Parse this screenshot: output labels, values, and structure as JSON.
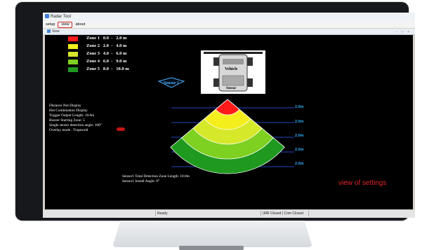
{
  "window": {
    "title": "Radar Tool",
    "menu": [
      "setup",
      "view",
      "about"
    ],
    "active_menu": "view",
    "subwindow_title": "View",
    "controls": "– □ ×"
  },
  "legend": [
    {
      "label": "Zone 1",
      "from": "0.0",
      "to": "2.0 m",
      "color": "#ff1a1a"
    },
    {
      "label": "Zone 2",
      "from": "2.0",
      "to": "4.0 m",
      "color": "#f4ee1c"
    },
    {
      "label": "Zone 3",
      "from": "4.0",
      "to": "6.0 m",
      "color": "#d6e82a"
    },
    {
      "label": "Zone 4",
      "from": "6.0",
      "to": "9.0 m",
      "color": "#7ed021"
    },
    {
      "label": "Zone 5",
      "from": "8.0",
      "to": "10.0 m",
      "color": "#1f9a1f"
    }
  ],
  "sensor_badge": "Sensor 1",
  "vehicle": {
    "label": "Vehicle",
    "sensor": "Sensor"
  },
  "info_lines": [
    "Distance Not Display",
    "Hot Combination Display",
    "Trigger Output Length: 10.0m",
    "Buzzer Starting Zone: 5",
    "Single  sensor  detection angle: 100°",
    "Overlay mode : Trapezoid"
  ],
  "zone_distance_labels": [
    "2.0m",
    "2.0m",
    "2.0m",
    "2.0m",
    "2.0m"
  ],
  "bottom_lines": [
    "Sensor1 Total Detection Zone Length: 10.0m",
    "Sensor1 Install Angle: 0°"
  ],
  "annotation": "view of settings",
  "status": {
    "ready": "Ready",
    "connection": "(MR Closed | Com Closed"
  }
}
